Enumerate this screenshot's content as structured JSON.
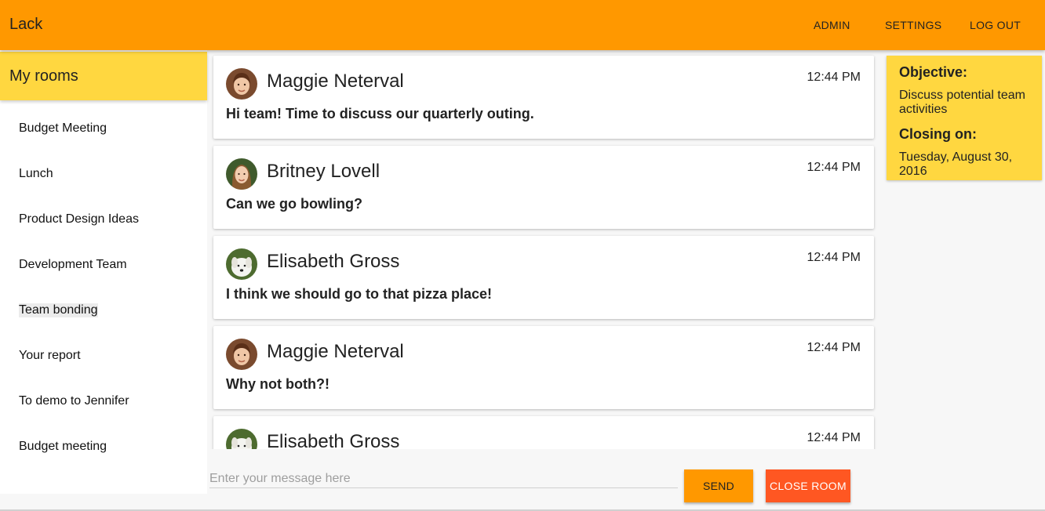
{
  "app": {
    "title": "Lack"
  },
  "nav": {
    "admin": "ADMIN",
    "settings": "SETTINGS",
    "logout": "LOG OUT"
  },
  "sidebar": {
    "header": "My rooms",
    "rooms": [
      {
        "label": "Budget Meeting"
      },
      {
        "label": "Lunch"
      },
      {
        "label": "Product Design Ideas"
      },
      {
        "label": "Development Team"
      },
      {
        "label": "Team bonding",
        "active": true
      },
      {
        "label": "Your report"
      },
      {
        "label": "To demo to Jennifer"
      },
      {
        "label": "Budget meeting"
      }
    ]
  },
  "messages": [
    {
      "sender": "Maggie Neterval",
      "time": "12:44 PM",
      "text": "Hi team! Time to discuss our quarterly outing.",
      "avatar": "woman-brown-hair-avatar"
    },
    {
      "sender": "Britney Lovell",
      "time": "12:44 PM",
      "text": "Can we go bowling?",
      "avatar": "woman-long-hair-avatar"
    },
    {
      "sender": "Elisabeth Gross",
      "time": "12:44 PM",
      "text": "I think we should go to that pizza place!",
      "avatar": "white-dog-avatar"
    },
    {
      "sender": "Maggie Neterval",
      "time": "12:44 PM",
      "text": "Why not both?!",
      "avatar": "woman-brown-hair-avatar"
    },
    {
      "sender": "Elisabeth Gross",
      "time": "12:44 PM",
      "text": "",
      "avatar": "white-dog-avatar"
    }
  ],
  "composer": {
    "placeholder": "Enter your message here",
    "value": "",
    "send_label": "SEND",
    "close_label": "CLOSE ROOM"
  },
  "info": {
    "objective_label": "Objective:",
    "objective": "Discuss potential team activities",
    "closing_label": "Closing on:",
    "closing_date": "Tuesday, August 30, 2016"
  },
  "colors": {
    "primary": "#ff9800",
    "accent": "#ffd740",
    "danger": "#ff5722"
  }
}
